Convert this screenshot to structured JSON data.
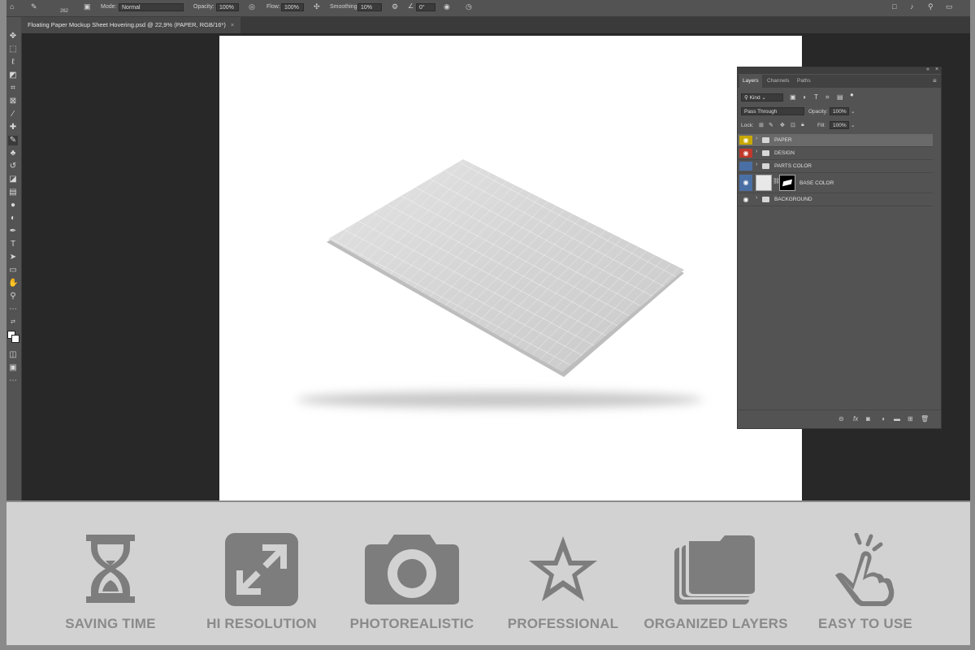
{
  "options_bar": {
    "brush_size": "262",
    "mode_label": "Mode:",
    "mode_value": "Normal",
    "opacity_label": "Opacity:",
    "opacity_value": "100%",
    "flow_label": "Flow:",
    "flow_value": "100%",
    "smoothing_label": "Smoothing:",
    "smoothing_value": "10%",
    "angle_value": "0°"
  },
  "document_tab": {
    "title": "Floating Paper Mockup Sheet Hovering.psd @ 22,9% (PAPER, RGB/16*)",
    "close": "×"
  },
  "layers_panel": {
    "tabs": [
      "Layers",
      "Channels",
      "Paths"
    ],
    "filter_kind": "Kind",
    "blend_mode": "Pass Through",
    "opacity_label": "Opacity:",
    "opacity_value": "100%",
    "lock_label": "Lock:",
    "fill_label": "Fill:",
    "fill_value": "100%",
    "layers": [
      {
        "name": "PAPER",
        "color": "#c8a800",
        "type": "group",
        "visible": true,
        "selected": true
      },
      {
        "name": "DESIGN",
        "color": "#c0392b",
        "type": "group",
        "visible": true,
        "selected": false
      },
      {
        "name": "PARTS COLOR",
        "color": "#4a6fa5",
        "type": "group",
        "visible": false,
        "selected": false
      },
      {
        "name": "BASE COLOR",
        "color": "#4a6fa5",
        "type": "smart",
        "visible": true,
        "selected": false
      },
      {
        "name": "BACKGROUND",
        "color": "#535353",
        "type": "group",
        "visible": true,
        "selected": false
      }
    ]
  },
  "features": [
    {
      "label": "SAVING TIME",
      "icon": "hourglass-icon"
    },
    {
      "label": "HI RESOLUTION",
      "icon": "expand-arrows-icon"
    },
    {
      "label": "PHOTOREALISTIC",
      "icon": "camera-icon"
    },
    {
      "label": "PROFESSIONAL",
      "icon": "star-icon"
    },
    {
      "label": "ORGANIZED LAYERS",
      "icon": "stacked-folders-icon"
    },
    {
      "label": "EASY TO USE",
      "icon": "tap-hand-icon"
    }
  ],
  "colors": {
    "feature_icon": "#7d7d7d",
    "feature_strip": "#d2d2d2",
    "app_dark": "#282828",
    "panel": "#535353"
  }
}
